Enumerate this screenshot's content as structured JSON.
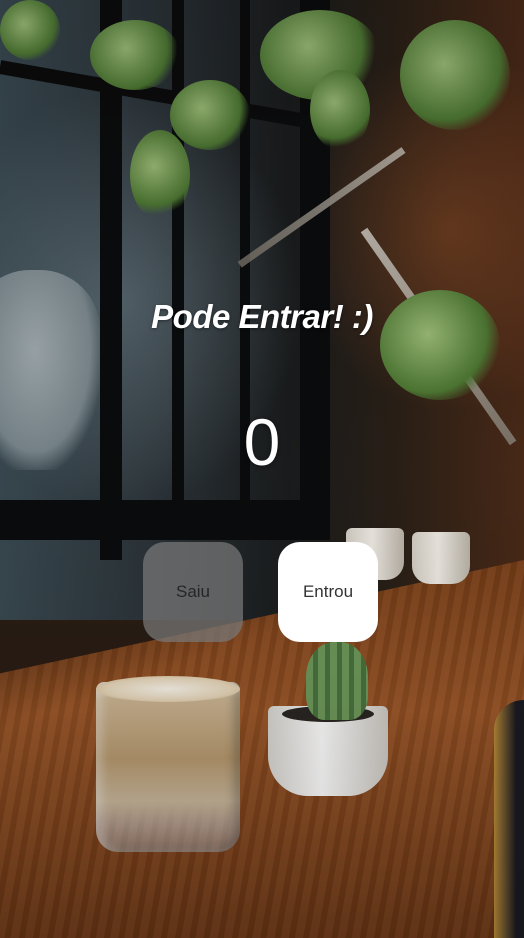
{
  "screen": {
    "title": "Pode Entrar! :)",
    "counter_value": "0"
  },
  "buttons": {
    "exit_label": "Saiu",
    "enter_label": "Entrou"
  },
  "colors": {
    "text": "#ffffff",
    "exit_button_bg": "#787878",
    "enter_button_bg": "#ffffff"
  }
}
